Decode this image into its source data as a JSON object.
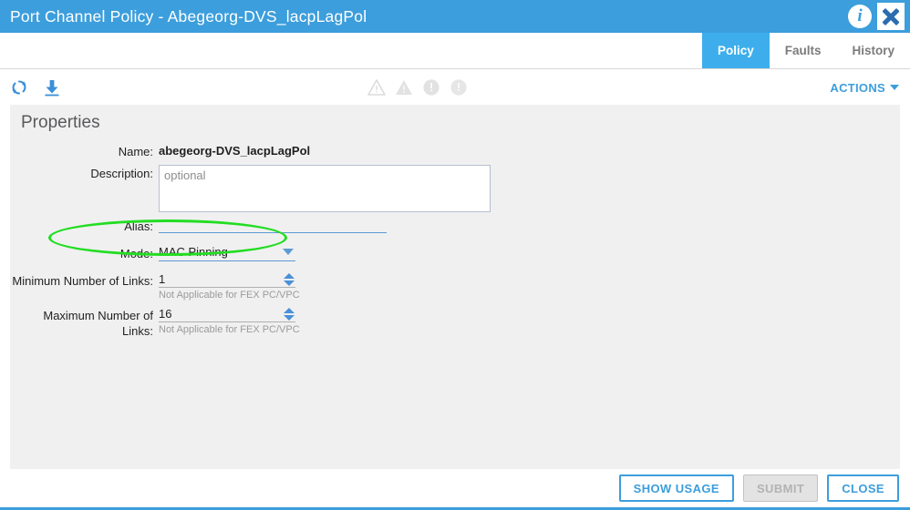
{
  "window": {
    "title": "Port Channel Policy - Abegeorg-DVS_lacpLagPol",
    "info_icon": "info-icon",
    "close_icon": "close-icon"
  },
  "tabs": [
    {
      "label": "Policy",
      "active": true
    },
    {
      "label": "Faults",
      "active": false
    },
    {
      "label": "History",
      "active": false
    }
  ],
  "toolbar": {
    "refresh_icon": "refresh-icon",
    "download_icon": "download-icon",
    "status_icons": [
      "warning-triangle-outline-icon",
      "warning-triangle-filled-icon",
      "info-circle-filled-icon",
      "info-circle-filled-icon"
    ],
    "actions_label": "ACTIONS"
  },
  "properties": {
    "section_title": "Properties",
    "name": {
      "label": "Name:",
      "value": "abegeorg-DVS_lacpLagPol"
    },
    "description": {
      "label": "Description:",
      "value": "",
      "placeholder": "optional"
    },
    "alias": {
      "label": "Alias:",
      "value": ""
    },
    "mode": {
      "label": "Mode:",
      "value": "MAC Pinning"
    },
    "min_links": {
      "label": "Minimum Number of Links:",
      "value": "1",
      "helper": "Not Applicable for FEX PC/VPC"
    },
    "max_links": {
      "label": "Maximum Number of Links:",
      "value": "16",
      "helper": "Not Applicable for FEX PC/VPC"
    }
  },
  "annotation": {
    "shape": "ellipse",
    "color": "#22dd22",
    "targets": "Mode: MAC Pinning"
  },
  "footer": {
    "show_usage_label": "SHOW USAGE",
    "submit_label": "SUBMIT",
    "submit_disabled": true,
    "close_label": "CLOSE"
  },
  "colors": {
    "header_blue": "#3c9edc",
    "tab_active_blue": "#3daeeb",
    "panel_grey": "#f0f0f0",
    "accent_blue": "#5b9bd5",
    "annotation_green": "#22dd22"
  }
}
